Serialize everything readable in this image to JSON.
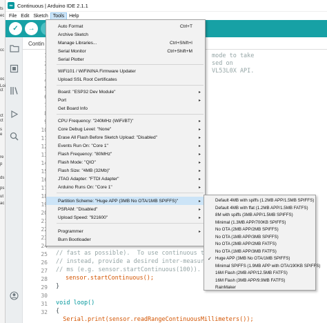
{
  "window": {
    "title": "Continuous | Arduino IDE 2.1.1"
  },
  "menubar": [
    "File",
    "Edit",
    "Sketch",
    "Tools",
    "Help"
  ],
  "left_strip": [
    "ts",
    "ec",
    "cc",
    "oc",
    "Loi",
    "ct",
    "ct",
    "ct",
    "s",
    "e",
    "re",
    "p",
    "ds",
    "ps",
    "ut",
    "ac"
  ],
  "toolbar": {
    "verify": "✓",
    "upload": "→",
    "debug": "●"
  },
  "tab": {
    "label": "Contin"
  },
  "editor": {
    "line_numbers": [
      "1",
      "2",
      "3",
      "4",
      "5",
      "6",
      "7",
      "8",
      "9",
      "10",
      "11",
      "12",
      "13",
      "14",
      "15",
      "16",
      "17",
      "18",
      "19",
      "20",
      "21",
      "22",
      "23",
      "24",
      "25",
      "26",
      "27",
      "28",
      "29",
      "30",
      "31",
      "32"
    ],
    "partial_right": [
      "mode to take",
      "sed on",
      "VL53L0X API."
    ],
    "bottom_code": [
      "// fast as possible).  To use continuous t",
      "// instead, provide a desired inter-measure",
      "// ms (e.g. sensor.startContinuous(100)).",
      "sensor.startContinuous();",
      "}",
      "",
      "void loop()",
      "{",
      "  Serial.print(sensor.readRangeContinuousMillimeters());"
    ]
  },
  "tools_menu": {
    "items": [
      {
        "label": "Auto Format",
        "shortcut": "Ctrl+T"
      },
      {
        "label": "Archive Sketch"
      },
      {
        "label": "Manage Libraries...",
        "shortcut": "Ctrl+Shift+I"
      },
      {
        "label": "Serial Monitor",
        "shortcut": "Ctrl+Shift+M"
      },
      {
        "label": "Serial Plotter"
      },
      {
        "label": "WiFi101 / WiFiNINA Firmware Updater"
      },
      {
        "label": "Upload SSL Root Certificates"
      },
      {
        "label": "Board: \"ESP32 Dev Module\"",
        "arrow": "▸"
      },
      {
        "label": "Port",
        "arrow": "▸"
      },
      {
        "label": "Get Board Info"
      },
      {
        "label": "CPU Frequency: \"240MHz (WiFi/BT)\"",
        "arrow": "▸"
      },
      {
        "label": "Core Debug Level: \"None\"",
        "arrow": "▸"
      },
      {
        "label": "Erase All Flash Before Sketch Upload: \"Disabled\"",
        "arrow": "▸"
      },
      {
        "label": "Events Run On: \"Core 1\"",
        "arrow": "▸"
      },
      {
        "label": "Flash Frequency: \"80MHz\"",
        "arrow": "▸"
      },
      {
        "label": "Flash Mode: \"QIO\"",
        "arrow": "▸"
      },
      {
        "label": "Flash Size: \"4MB (32Mb)\"",
        "arrow": "▸"
      },
      {
        "label": "JTAG Adapter: \"FTDI Adapter\"",
        "arrow": "▸"
      },
      {
        "label": "Arduino Runs On: \"Core 1\"",
        "arrow": "▸"
      },
      {
        "label": "Partition Scheme: \"Huge APP (3MB No OTA/1MB SPIFFS)\"",
        "arrow": "▸"
      },
      {
        "label": "PSRAM: \"Disabled\"",
        "arrow": "▸"
      },
      {
        "label": "Upload Speed: \"921600\"",
        "arrow": "▸"
      },
      {
        "label": "Programmer",
        "arrow": "▸"
      },
      {
        "label": "Burn Bootloader"
      }
    ]
  },
  "partition_submenu": {
    "items": [
      "Default 4MB with spiffs (1.2MB APP/1.5MB SPIFFS)",
      "Default 4MB with ffat (1.2MB APP/1.5MB FATFS)",
      "8M with spiffs (3MB APP/1.5MB SPIFFS)",
      "Minimal (1.3MB APP/700KB SPIFFS)",
      "No OTA (2MB APP/2MB SPIFFS)",
      "No OTA (1MB APP/3MB SPIFFS)",
      "No OTA (2MB APP/2MB FATFS)",
      "No OTA (1MB APP/3MB FATFS)",
      "Huge APP (3MB No OTA/1MB SPIFFS)",
      "Minimal SPIFFS (1.9MB APP with OTA/190KB SPIFFS)",
      "16M Flash (2MB APP/12.5MB FATFS)",
      "16M Flash (3MB APP/9.9MB FATFS)",
      "RainMaker"
    ],
    "checkmark": "✓"
  },
  "colors": {
    "toolbar": "#17a1a5",
    "menu_highlight": "#cce4f7",
    "menu_bg": "#f2f2f2"
  },
  "icons": [
    "folder-icon",
    "board-icon",
    "library-icon",
    "debug-icon",
    "search-icon",
    "account-icon"
  ]
}
